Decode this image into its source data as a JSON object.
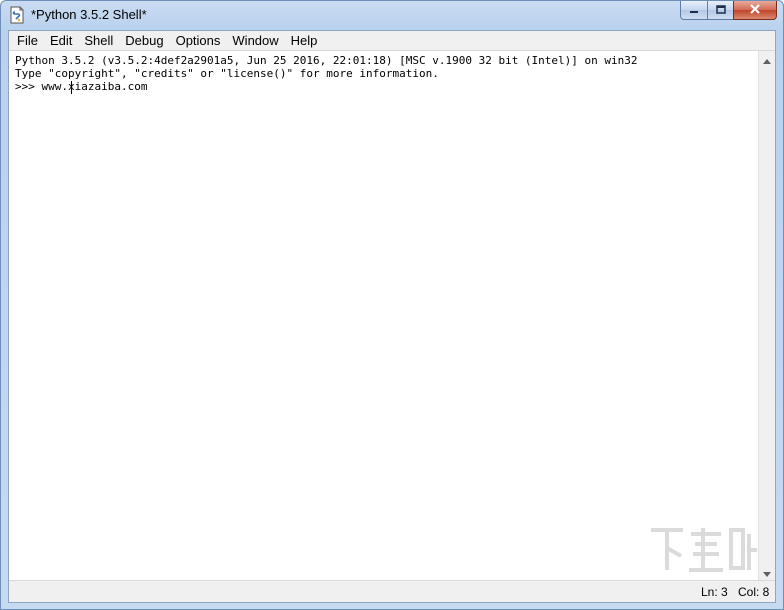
{
  "window": {
    "title": "*Python 3.5.2 Shell*"
  },
  "menu": [
    {
      "label": "File"
    },
    {
      "label": "Edit"
    },
    {
      "label": "Shell"
    },
    {
      "label": "Debug"
    },
    {
      "label": "Options"
    },
    {
      "label": "Window"
    },
    {
      "label": "Help"
    }
  ],
  "shell": {
    "lines": [
      "Python 3.5.2 (v3.5.2:4def2a2901a5, Jun 25 2016, 22:01:18) [MSC v.1900 32 bit (Intel)] on win32",
      "Type \"copyright\", \"credits\" or \"license()\" for more information.",
      ">>> www.xiazaiba.com"
    ]
  },
  "status": {
    "line": "Ln: 3",
    "col": "Col: 8"
  },
  "icons": {
    "app": "python-idle-icon",
    "minimize": "minimize-icon",
    "maximize": "maximize-icon",
    "close": "close-icon",
    "scroll_up": "arrow-up-icon",
    "scroll_down": "arrow-down-icon"
  },
  "colors": {
    "titlebar": "#c9dcf2",
    "close_button": "#c2432b",
    "text": "#000000"
  }
}
